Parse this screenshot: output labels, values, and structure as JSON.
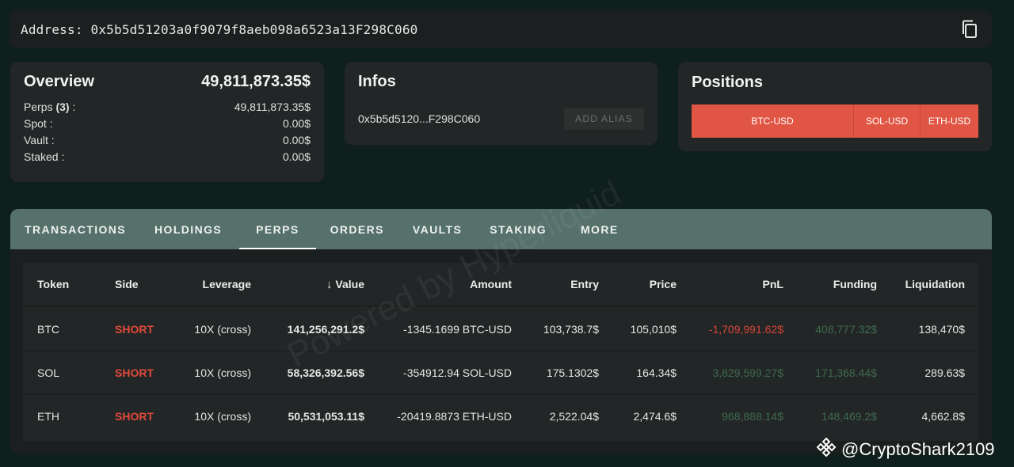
{
  "address": {
    "label": "Address:",
    "value": "0x5b5d51203a0f9079f8aeb098a6523a13F298C060"
  },
  "overview": {
    "title": "Overview",
    "total": "49,811,873.35$",
    "rows": [
      {
        "label": "Perps",
        "count": "(3)",
        "suffix": ":",
        "value": "49,811,873.35$"
      },
      {
        "label": "Spot :",
        "value": "0.00$"
      },
      {
        "label": "Vault :",
        "value": "0.00$"
      },
      {
        "label": "Staked :",
        "value": "0.00$"
      }
    ]
  },
  "infos": {
    "title": "Infos",
    "short_address": "0x5b5d5120...F298C060",
    "alias_button": "ADD ALIAS"
  },
  "positions": {
    "title": "Positions",
    "segments": [
      {
        "label": "BTC-USD",
        "color": "#e05544"
      },
      {
        "label": "SOL-USD",
        "color": "#e05544"
      },
      {
        "label": "ETH-USD",
        "color": "#e05544"
      }
    ]
  },
  "tabs": [
    "TRANSACTIONS",
    "HOLDINGS",
    "PERPS",
    "ORDERS",
    "VAULTS",
    "STAKING",
    "MORE"
  ],
  "active_tab": "PERPS",
  "table": {
    "headers": [
      "Token",
      "Side",
      "Leverage",
      "Value",
      "Amount",
      "Entry",
      "Price",
      "PnL",
      "Funding",
      "Liquidation"
    ],
    "sort_icon": "arrow-down-icon",
    "rows": [
      {
        "token": "BTC",
        "side": "SHORT",
        "leverage": "10X (cross)",
        "value": "141,256,291.2$",
        "amount": "-1345.1699 BTC-USD",
        "entry": "103,738.7$",
        "price": "105,010$",
        "pnl": "-1,709,991.62$",
        "funding": "408,777.32$",
        "liquidation": "138,470$"
      },
      {
        "token": "SOL",
        "side": "SHORT",
        "leverage": "10X (cross)",
        "value": "58,326,392.56$",
        "amount": "-354912.94 SOL-USD",
        "entry": "175.1302$",
        "price": "164.34$",
        "pnl": "3,829,599.27$",
        "funding": "171,368.44$",
        "liquidation": "289.63$"
      },
      {
        "token": "ETH",
        "side": "SHORT",
        "leverage": "10X (cross)",
        "value": "50,531,053.11$",
        "amount": "-20419.8873 ETH-USD",
        "entry": "2,522.04$",
        "price": "2,474.6$",
        "pnl": "968,888.14$",
        "funding": "148,469.2$",
        "liquidation": "4,662.8$"
      }
    ]
  },
  "colors": {
    "short": "#e04a3a",
    "pnl_negative": "#d9443a",
    "pnl_positive": "#3e6a4f",
    "tab_bar": "#56706a",
    "position_bar": "#e05544"
  },
  "watermark": "Powered by Hyperliquid",
  "credit": {
    "icon": "binance-logo-icon",
    "text": "@CryptoShark2109"
  }
}
